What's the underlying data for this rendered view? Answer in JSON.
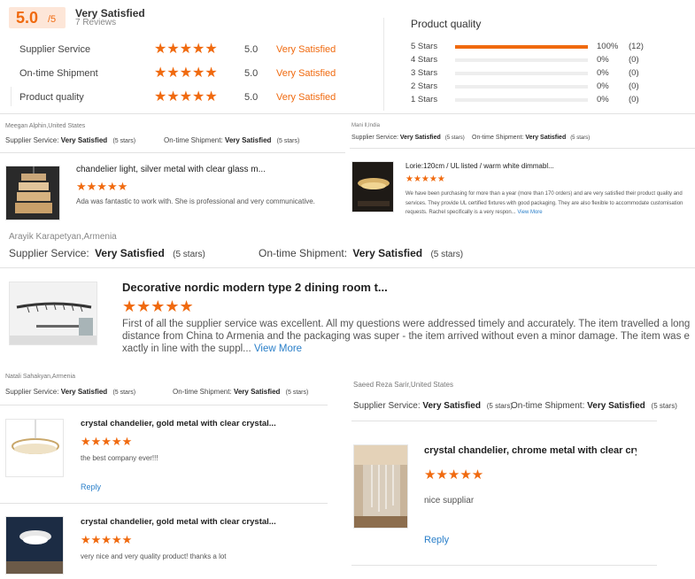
{
  "summary": {
    "score": "5.0",
    "score_unit": "/5",
    "verdict": "Very Satisfied",
    "review_count": "7 Reviews",
    "ratings": [
      {
        "label": "Supplier Service",
        "stars": "★★★★★",
        "value": "5.0",
        "verdict": "Very Satisfied"
      },
      {
        "label": "On-time Shipment",
        "stars": "★★★★★",
        "value": "5.0",
        "verdict": "Very Satisfied"
      },
      {
        "label": "Product quality",
        "stars": "★★★★★",
        "value": "5.0",
        "verdict": "Very Satisfied"
      }
    ]
  },
  "quality": {
    "title": "Product quality",
    "rows": [
      {
        "label": "5 Stars",
        "fraction": 1.0,
        "percent": "100%",
        "count": "(12)"
      },
      {
        "label": "4 Stars",
        "fraction": 0,
        "percent": "0%",
        "count": "(0)"
      },
      {
        "label": "3 Stars",
        "fraction": 0,
        "percent": "0%",
        "count": "(0)"
      },
      {
        "label": "2 Stars",
        "fraction": 0,
        "percent": "0%",
        "count": "(0)"
      },
      {
        "label": "1 Stars",
        "fraction": 0,
        "percent": "0%",
        "count": "(0)"
      }
    ]
  },
  "labels": {
    "supplier_service": "Supplier Service:",
    "ontime_shipment": "On-time Shipment:",
    "very_satisfied": "Very Satisfied",
    "five_stars": "(5 stars)",
    "stars": "★★★★★",
    "reply": "Reply",
    "view_more": "View More"
  },
  "reviews": {
    "r1": {
      "reviewer": "Meegan Alphin,United States",
      "product": "chandelier light, silver metal with clear glass m...",
      "text": "Ada was fantastic to work with. She is professional and very communicative."
    },
    "r2": {
      "reviewer": "Mani ll,India",
      "product": "Lorie:120cm / UL listed / warm white dimmabl...",
      "text": "We have been purchasing for more than a year (more than 170 orders) and are very satisfied their product quality and services. They provide UL certified fixtures with good packaging. They are also flexible to accommodate customisation requests. Rachel specifically is a very respon..."
    },
    "r3": {
      "reviewer": "Arayik Karapetyan,Armenia",
      "product": "Decorative nordic modern type 2 dining room t...",
      "text": "First of all the supplier service was excellent. All my questions were addressed timely and accurately. The item travelled a long distance from China to Armenia and the packaging was super - the item arrived without even a minor damage. The item was exactly in line with the suppl..."
    },
    "r4": {
      "reviewer": "Natali Sahakyan,Armenia",
      "product": "crystal chandelier, gold metal with clear crystal...",
      "text": "the best company ever!!!"
    },
    "r5": {
      "product": "crystal chandelier, gold metal with clear crystal...",
      "text": "very nice and very quality product! thanks a lot"
    },
    "r6": {
      "reviewer": "Saeed Reza Sarir,United States",
      "product": "crystal chandelier, chrome metal with clear cry...",
      "text": "nice suppliar"
    }
  },
  "colors": {
    "accent": "#f06a0f",
    "link": "#2a7fc9",
    "score_bg": "#fde6d8"
  }
}
